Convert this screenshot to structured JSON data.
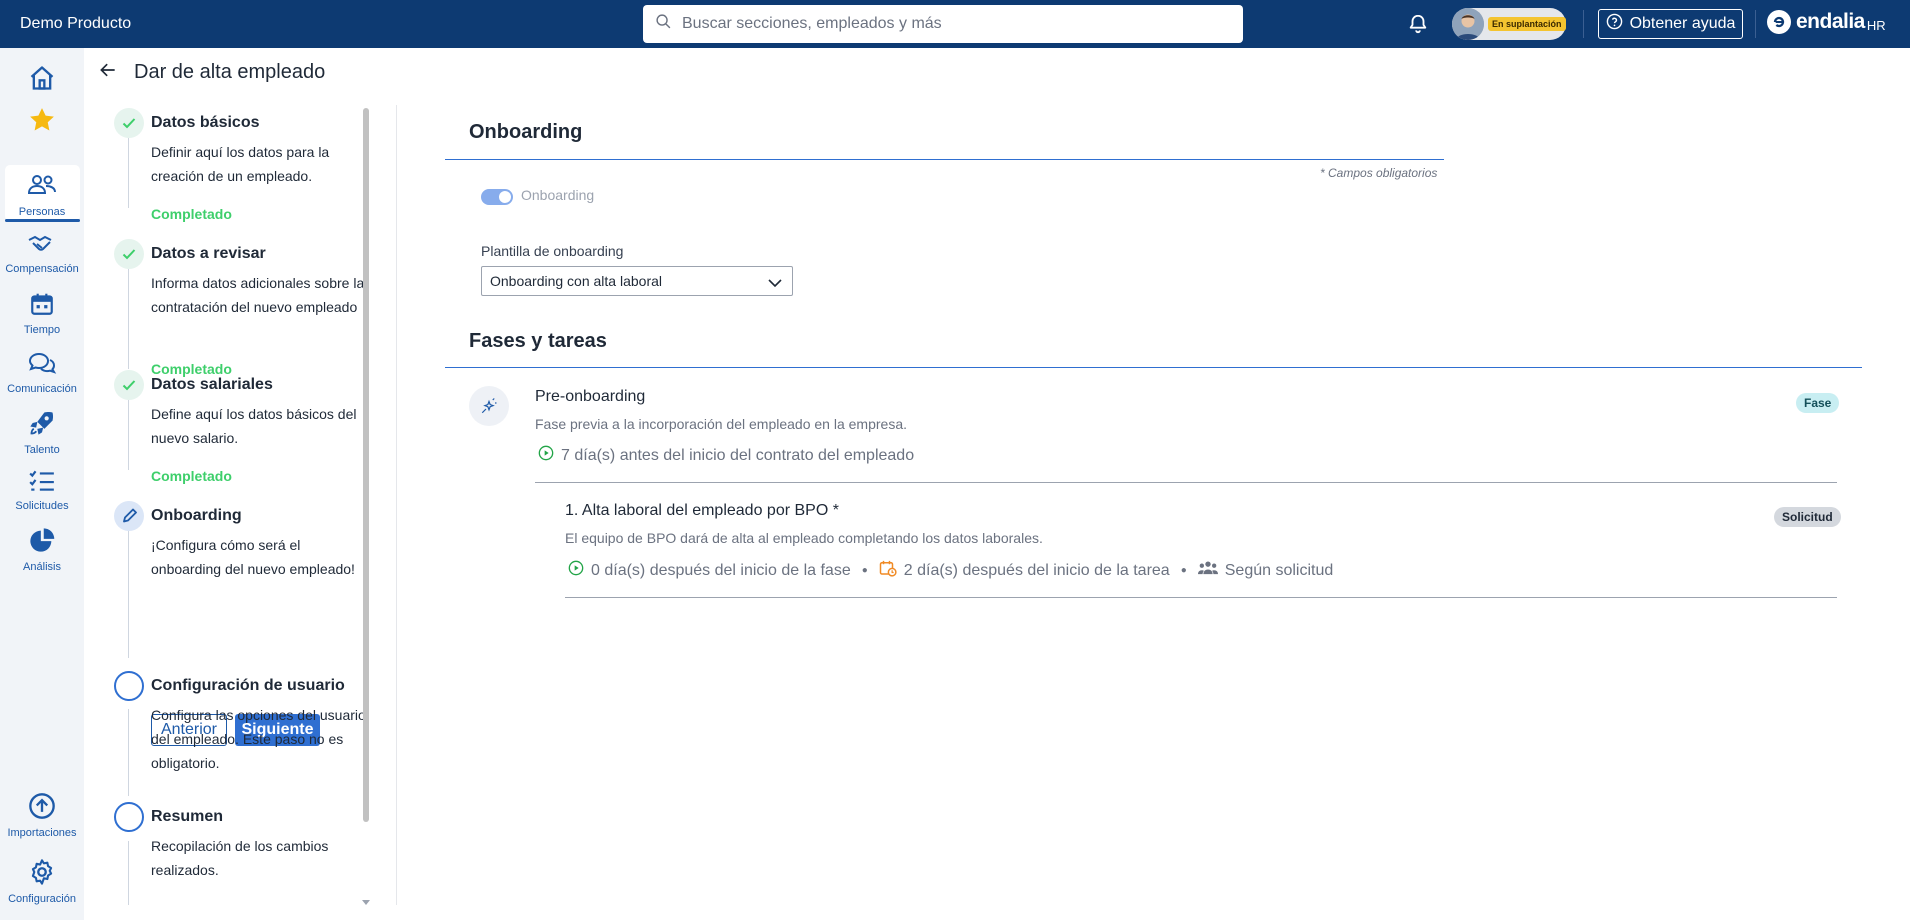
{
  "app": {
    "title": "Demo Producto"
  },
  "search": {
    "placeholder": "Buscar secciones, empleados y más"
  },
  "user": {
    "impersonation_label": "En suplantación"
  },
  "help": {
    "label": "Obtener ayuda"
  },
  "brand": {
    "name": "endalia",
    "suffix": "HR"
  },
  "nav": {
    "items": [
      {
        "label": "Personas",
        "icon": "people-icon"
      },
      {
        "label": "Compensación",
        "icon": "handshake-icon"
      },
      {
        "label": "Tiempo",
        "icon": "calendar-icon"
      },
      {
        "label": "Comunicación",
        "icon": "chat-icon"
      },
      {
        "label": "Talento",
        "icon": "rocket-icon"
      },
      {
        "label": "Solicitudes",
        "icon": "checklist-icon"
      },
      {
        "label": "Análisis",
        "icon": "pie-chart-icon"
      },
      {
        "label": "Importaciones",
        "icon": "upload-icon"
      },
      {
        "label": "Configuración",
        "icon": "gear-icon"
      }
    ]
  },
  "page": {
    "title": "Dar de alta empleado"
  },
  "steps": [
    {
      "title": "Datos básicos",
      "desc": "Definir aquí los datos para la creación de un empleado.",
      "status": "Completado"
    },
    {
      "title": "Datos a revisar",
      "desc": "Informa datos adicionales sobre la contratación del nuevo empleado",
      "status": "Completado"
    },
    {
      "title": "Datos salariales",
      "desc": "Define aquí los datos básicos del nuevo salario.",
      "status": "Completado"
    },
    {
      "title": "Onboarding",
      "desc": "¡Configura cómo será el onboarding del nuevo empleado!",
      "prev_label": "Anterior",
      "next_label": "Siguiente"
    },
    {
      "title": "Configuración de usuario",
      "desc": "Configura las opciones del usuario del empleado. Este paso no es obligatorio."
    },
    {
      "title": "Resumen",
      "desc": "Recopilación de los cambios realizados."
    }
  ],
  "onboarding": {
    "title": "Onboarding",
    "required_note": "* Campos obligatorios",
    "toggle_label": "Onboarding",
    "toggle_on": true,
    "template_label": "Plantilla de onboarding",
    "template_value": "Onboarding con alta laboral"
  },
  "phases": {
    "title": "Fases y tareas",
    "items": [
      {
        "title": "Pre-onboarding",
        "desc": "Fase previa a la incorporación del empleado en la empresa.",
        "timing": "7 día(s) antes del inicio del contrato del empleado",
        "badge": "Fase",
        "tasks": [
          {
            "title": "1. Alta laboral del empleado por BPO *",
            "desc": "El equipo de BPO dará de alta al empleado completando los datos laborales.",
            "start": "0 día(s) después del inicio de la fase",
            "due": "2 día(s) después del inicio de la tarea",
            "assignee": "Según solicitud",
            "badge": "Solicitud"
          }
        ]
      }
    ]
  },
  "colors": {
    "topbar": "#0d3a72",
    "accent": "#2f6fd1",
    "success": "#3ecf6b"
  }
}
